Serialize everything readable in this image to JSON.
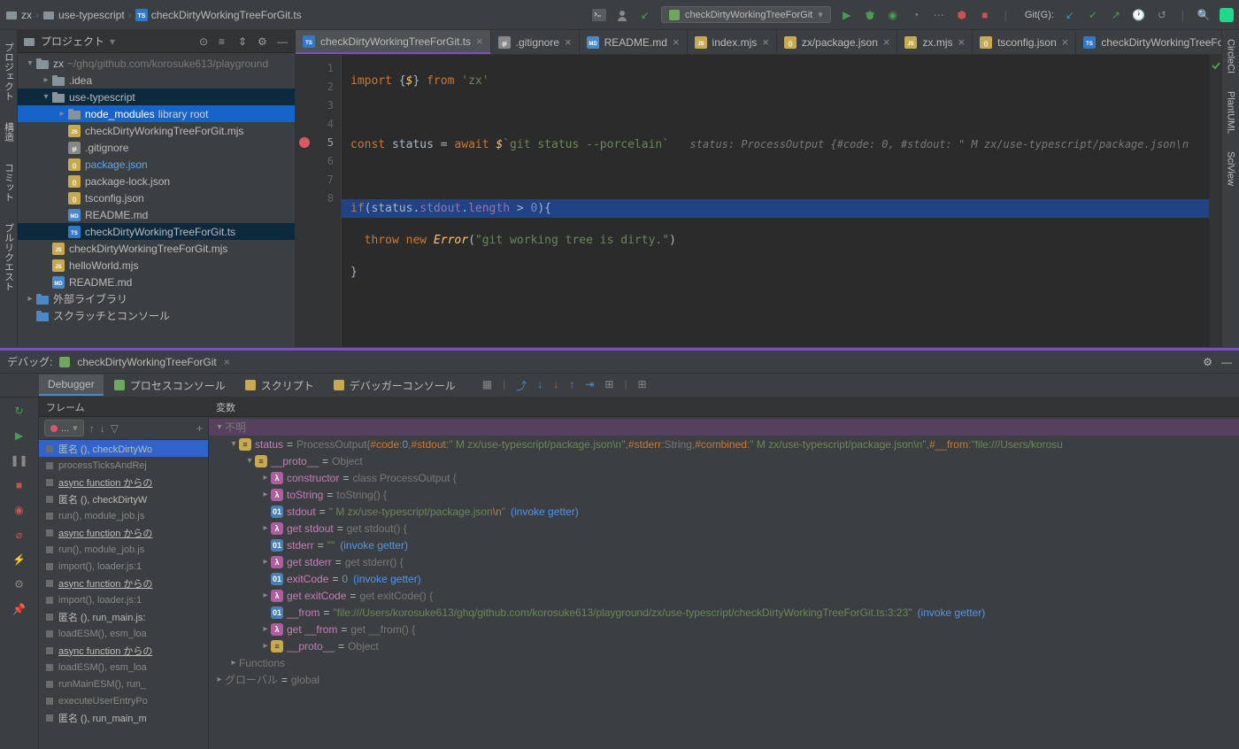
{
  "breadcrumb": {
    "root": "zx",
    "folder": "use-typescript",
    "file": "checkDirtyWorkingTreeForGit.ts"
  },
  "runConfig": "checkDirtyWorkingTreeForGit",
  "gitLabel": "Git(G):",
  "leftStripe": {
    "project": "プロジェクト",
    "structure": "構造",
    "commit": "コミット",
    "pullreq": "プルリクエスト"
  },
  "rightStripe": {
    "circleci": "CircleCI",
    "plantuml": "PlantUML",
    "sciview": "SciView"
  },
  "projectPanel": {
    "title": "プロジェクト"
  },
  "tree": [
    {
      "d": 0,
      "arrow": "▾",
      "kind": "folder-root",
      "label": "zx",
      "hint": "~/ghq/github.com/korosuke613/playground"
    },
    {
      "d": 1,
      "arrow": "▸",
      "kind": "folder",
      "label": ".idea"
    },
    {
      "d": 1,
      "arrow": "▾",
      "kind": "folder",
      "label": "use-typescript",
      "selSecondary": true
    },
    {
      "d": 2,
      "arrow": "▸",
      "kind": "folder-lib",
      "label": "node_modules",
      "hint": "library root",
      "selPrimary": true
    },
    {
      "d": 2,
      "arrow": "",
      "kind": "js",
      "label": "checkDirtyWorkingTreeForGit.mjs"
    },
    {
      "d": 2,
      "arrow": "",
      "kind": "gi",
      "label": ".gitignore"
    },
    {
      "d": 2,
      "arrow": "",
      "kind": "json",
      "label": "package.json",
      "blue": true
    },
    {
      "d": 2,
      "arrow": "",
      "kind": "json",
      "label": "package-lock.json"
    },
    {
      "d": 2,
      "arrow": "",
      "kind": "json",
      "label": "tsconfig.json"
    },
    {
      "d": 2,
      "arrow": "",
      "kind": "md",
      "label": "README.md"
    },
    {
      "d": 2,
      "arrow": "",
      "kind": "ts",
      "label": "checkDirtyWorkingTreeForGit.ts",
      "selSecondary": true
    },
    {
      "d": 1,
      "arrow": "",
      "kind": "js",
      "label": "checkDirtyWorkingTreeForGit.mjs"
    },
    {
      "d": 1,
      "arrow": "",
      "kind": "js",
      "label": "helloWorld.mjs"
    },
    {
      "d": 1,
      "arrow": "",
      "kind": "md",
      "label": "README.md"
    },
    {
      "d": 0,
      "arrow": "▸",
      "kind": "lib",
      "label": "外部ライブラリ"
    },
    {
      "d": 0,
      "arrow": "",
      "kind": "scratch",
      "label": "スクラッチとコンソール"
    }
  ],
  "tabs": [
    {
      "icon": "ts",
      "label": "checkDirtyWorkingTreeForGit.ts",
      "active": true
    },
    {
      "icon": "gi",
      "label": ".gitignore"
    },
    {
      "icon": "md",
      "label": "README.md"
    },
    {
      "icon": "js",
      "label": "index.mjs"
    },
    {
      "icon": "json",
      "label": "zx/package.json"
    },
    {
      "icon": "js",
      "label": "zx.mjs"
    },
    {
      "icon": "json",
      "label": "tsconfig.json"
    },
    {
      "icon": "ts",
      "label": "checkDirtyWorkingTreeForGit.r"
    }
  ],
  "code": {
    "l1_import": "import",
    "l1_braceL": "{",
    "l1_sym": "$",
    "l1_braceR": "}",
    "l1_from": "from",
    "l1_pkg": "'zx'",
    "l3_const": "const",
    "l3_status": "status",
    "l3_eq": "=",
    "l3_await": "await",
    "l3_dollar": "$",
    "l3_tick": "`git status --porcelain`",
    "l3_inlay": "status: ProcessOutput {#code: 0, #stdout: \" M zx/use-typescript/package.json\\n",
    "l5_if": "if",
    "l5_open": "(",
    "l5_status": "status",
    "l5_dot1": ".",
    "l5_stdout": "stdout",
    "l5_dot2": ".",
    "l5_len": "length",
    "l5_gt": ">",
    "l5_zero": "0",
    "l5_close": "){",
    "l6_throw": "throw",
    "l6_new": "new",
    "l6_err": "Error",
    "l6_open": "(",
    "l6_str": "\"git working tree is dirty.\"",
    "l6_close": ")",
    "l7": "}"
  },
  "debugHeader": {
    "label": "デバッグ:",
    "config": "checkDirtyWorkingTreeForGit"
  },
  "debugTabs": {
    "debugger": "Debugger",
    "process": "プロセスコンソール",
    "script": "スクリプト",
    "dbgconsole": "デバッガーコンソール"
  },
  "framesPanel": {
    "title": "フレーム",
    "threadName": "...",
    "frames": [
      {
        "label": "匿名 (), checkDirtyWo",
        "sel": true,
        "em": true
      },
      {
        "label": "processTicksAndRej"
      },
      {
        "label": "async function からの",
        "u": true,
        "em": true
      },
      {
        "label": "匿名 (), checkDirtyW",
        "em": true
      },
      {
        "label": "run(), module_job.js"
      },
      {
        "label": "async function からの",
        "u": true,
        "em": true
      },
      {
        "label": "run(), module_job.js"
      },
      {
        "label": "import(), loader.js:1"
      },
      {
        "label": "async function からの",
        "u": true,
        "em": true
      },
      {
        "label": "import(), loader.js:1"
      },
      {
        "label": "匿名 (), run_main.js:",
        "em": true
      },
      {
        "label": "loadESM(), esm_loa"
      },
      {
        "label": "async function からの",
        "u": true,
        "em": true
      },
      {
        "label": "loadESM(), esm_loa"
      },
      {
        "label": "runMainESM(), run_"
      },
      {
        "label": "executeUserEntryPo"
      },
      {
        "label": "匿名 (), run_main_m",
        "em": true
      }
    ]
  },
  "varsPanel": {
    "title": "変数",
    "unknown": "不明",
    "statusLabel": "status",
    "statusType": "ProcessOutput ",
    "statusObj": {
      "codeKey": "#code",
      "codeVal": "0",
      "stdoutKey": "#stdout",
      "stdoutVal": "\" M zx/use-typescript/package.json\\n\"",
      "stderrKey": "#stderr",
      "stderrType": "String",
      "combinedKey": "#combined",
      "combinedVal": "\" M zx/use-typescript/package.json\\n\"",
      "fromKey": "#__from",
      "fromVal": "\"file:///Users/korosu"
    },
    "proto": "__proto__",
    "protoType": "Object",
    "constructor": "constructor",
    "constructorVal": "class ProcessOutput {",
    "toString": "toString",
    "toStringVal": "toString() {",
    "stdout": "stdout",
    "stdoutVal": "\" M zx/use-typescript/package.json",
    "stdoutEsc": "\\n",
    "stdoutEnd": "\"",
    "getStdout": "get stdout",
    "getStdoutVal": "get stdout() {",
    "stderr": "stderr",
    "stderrVal": "\"\"",
    "getStderr": "get stderr",
    "getStderrVal": "get stderr() {",
    "exitCode": "exitCode",
    "exitCodeVal": "0",
    "getExitCode": "get exitCode",
    "getExitCodeVal": "get exitCode() {",
    "from": "__from",
    "fromVal": "\"file:///Users/korosuke613/ghq/github.com/korosuke613/playground/zx/use-typescript/checkDirtyWorkingTreeForGit.ts:3:23\"",
    "getFrom": "get __from",
    "getFromVal": "get __from() {",
    "proto2": "__proto__",
    "proto2Type": "Object",
    "functions": "Functions",
    "global": "グローバル",
    "globalVal": "global",
    "invoke": "(invoke getter)"
  }
}
